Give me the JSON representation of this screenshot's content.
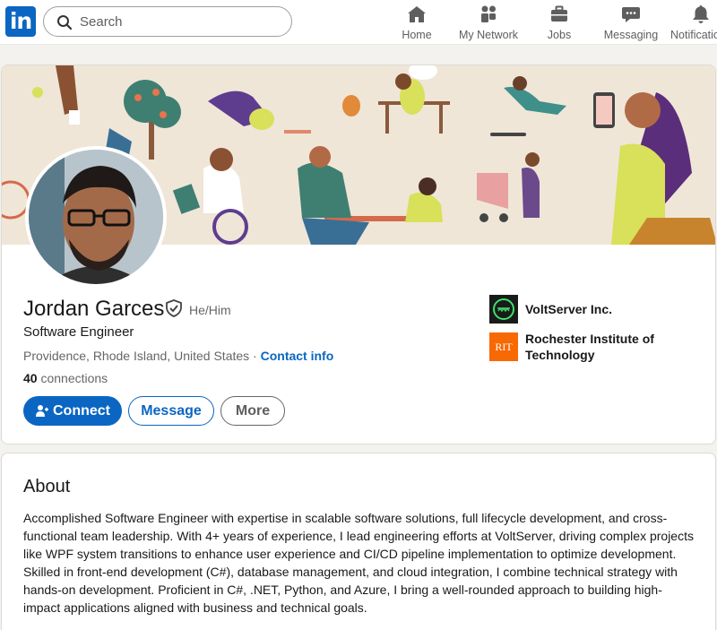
{
  "nav": {
    "logo_text": "in",
    "search_placeholder": "Search",
    "items": [
      {
        "label": "Home",
        "icon": "home-icon"
      },
      {
        "label": "My Network",
        "icon": "network-icon"
      },
      {
        "label": "Jobs",
        "icon": "briefcase-icon"
      },
      {
        "label": "Messaging",
        "icon": "messaging-icon"
      },
      {
        "label": "Notifications",
        "icon": "bell-icon"
      }
    ]
  },
  "profile": {
    "name": "Jordan Garces",
    "pronouns": "He/Him",
    "headline": "Software Engineer",
    "location": "Providence, Rhode Island, United States",
    "separator": " · ",
    "contact_label": "Contact info",
    "connections_count": "40",
    "connections_label": " connections",
    "buttons": {
      "connect": "Connect",
      "message": "Message",
      "more": "More"
    },
    "organizations": [
      {
        "name": "VoltServer Inc.",
        "logo_color": "#1a1a1a"
      },
      {
        "name": "Rochester Institute of Technology",
        "logo_text": "RIT",
        "logo_color": "#f76902"
      }
    ]
  },
  "about": {
    "title": "About",
    "text": "Accomplished Software Engineer with expertise in scalable software solutions, full lifecycle development, and cross-functional team leadership. With 4+ years of experience, I lead engineering efforts at VoltServer, driving complex projects like WPF system transitions to enhance user experience and CI/CD pipeline implementation to optimize development. Skilled in front-end development (C#), database management, and cloud integration, I combine technical strategy with hands-on development. Proficient in C#, .NET, Python, and Azure, I bring a well-rounded approach to building high-impact applications aligned with business and technical goals."
  },
  "colors": {
    "brand": "#0a66c2",
    "banner_bg": "#efe6d8"
  }
}
